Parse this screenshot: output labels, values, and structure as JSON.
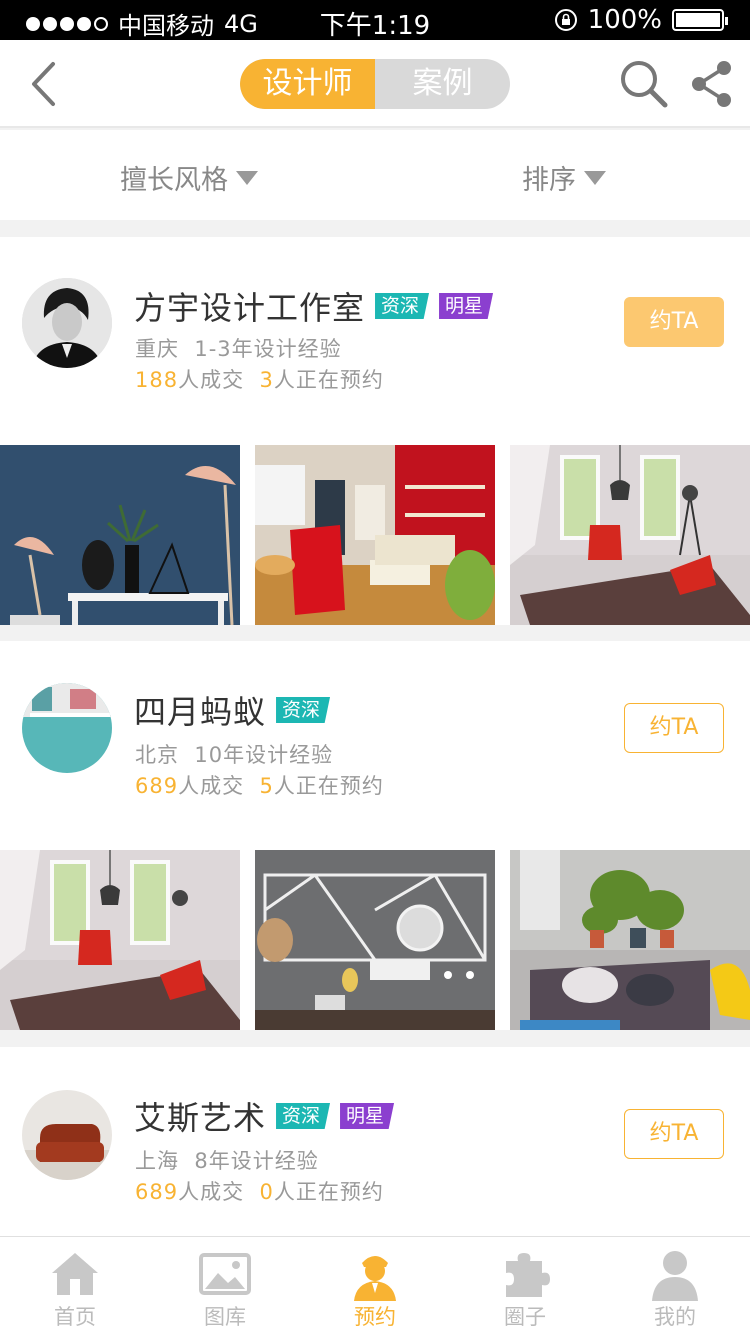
{
  "status_bar": {
    "carrier": "中国移动",
    "network": "4G",
    "time": "下午1:19",
    "battery": "100%",
    "signal_level": 0.8,
    "battery_level": 1.0
  },
  "nav": {
    "segment_designer": "设计师",
    "segment_case": "案例",
    "active_segment": "designer"
  },
  "filters": {
    "style": "擅长风格",
    "sort": "排序"
  },
  "colors": {
    "accent": "#f8b333",
    "senior_badge": "#1cb7b3",
    "star_badge": "#8b3fcf"
  },
  "designers": [
    {
      "name": "方宇设计工作室",
      "badges": [
        "资深",
        "明星"
      ],
      "location": "重庆",
      "experience": "1-3年设计经验",
      "deals": "188",
      "deals_suffix": "人成交",
      "booking": "3",
      "booking_suffix": "人正在预约",
      "action": "约TA"
    },
    {
      "name": "四月蚂蚁",
      "badges": [
        "资深"
      ],
      "location": "北京",
      "experience": "10年设计经验",
      "deals": "689",
      "deals_suffix": "人成交",
      "booking": "5",
      "booking_suffix": "人正在预约",
      "action": "约TA"
    },
    {
      "name": "艾斯艺术",
      "badges": [
        "资深",
        "明星"
      ],
      "location": "上海",
      "experience": "8年设计经验",
      "deals": "689",
      "deals_suffix": "人成交",
      "booking": "0",
      "booking_suffix": "人正在预约",
      "action": "约TA"
    }
  ],
  "tabs": [
    {
      "label": "首页",
      "icon": "home-icon"
    },
    {
      "label": "图库",
      "icon": "gallery-icon"
    },
    {
      "label": "预约",
      "icon": "designer-icon"
    },
    {
      "label": "圈子",
      "icon": "puzzle-icon"
    },
    {
      "label": "我的",
      "icon": "person-icon"
    }
  ]
}
